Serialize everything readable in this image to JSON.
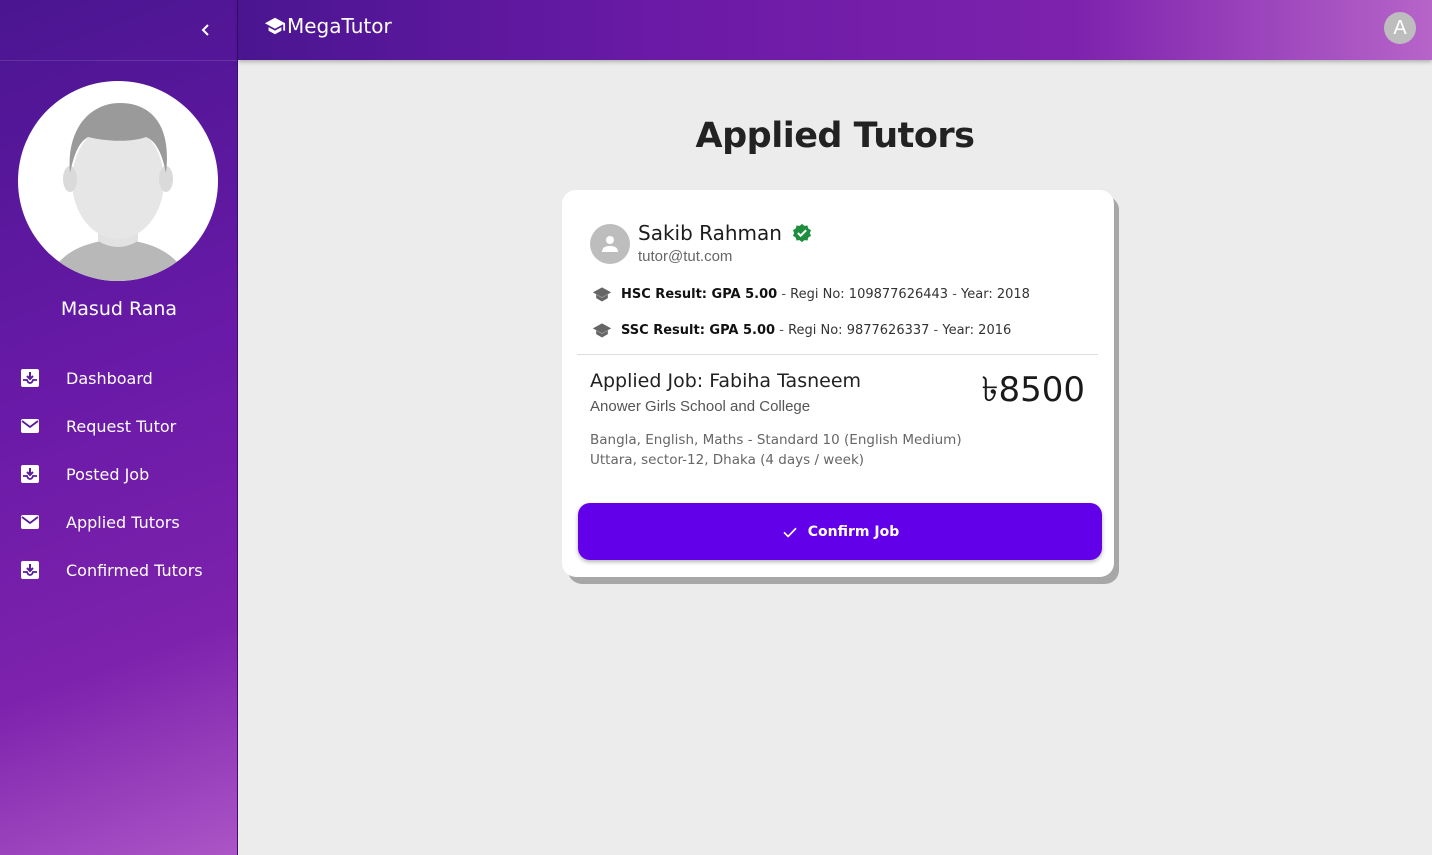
{
  "app": {
    "brand": "MegaTutor"
  },
  "topbar": {
    "avatar_letter": "A"
  },
  "sidebar": {
    "user_name": "Masud Rana",
    "items": [
      {
        "label": "Dashboard",
        "icon": "inbox-download-icon"
      },
      {
        "label": "Request Tutor",
        "icon": "mail-icon"
      },
      {
        "label": "Posted Job",
        "icon": "inbox-download-icon"
      },
      {
        "label": "Applied Tutors",
        "icon": "mail-icon"
      },
      {
        "label": "Confirmed Tutors",
        "icon": "inbox-download-icon"
      }
    ]
  },
  "page": {
    "title": "Applied Tutors"
  },
  "card": {
    "tutor_name": "Sakib Rahman",
    "tutor_email": "tutor@tut.com",
    "hsc": {
      "result": "HSC Result: GPA 5.00",
      "sep1": " - ",
      "regi": "Regi No: 109877626443",
      "sep2": " - ",
      "year": "Year: 2018"
    },
    "ssc": {
      "result": "SSC Result: GPA 5.00",
      "sep1": " - ",
      "regi": "Regi No: 9877626337",
      "sep2": " - ",
      "year": "Year: 2016"
    },
    "job_title": "Applied Job: Fabiha Tasneem",
    "job_school": "Anower Girls School and College",
    "price": "৳8500",
    "subjects_line": "Bangla, English, Maths - Standard 10 (English Medium)",
    "location_line": "Uttara, sector-12, Dhaka (4 days / week)",
    "confirm_label": "Confirm Job"
  },
  "colors": {
    "sidebar_gradient_start": "#4a1591",
    "sidebar_gradient_end": "#ab55c6",
    "button": "#6200ea",
    "verified": "#1e8e3e",
    "background": "#ececec"
  }
}
